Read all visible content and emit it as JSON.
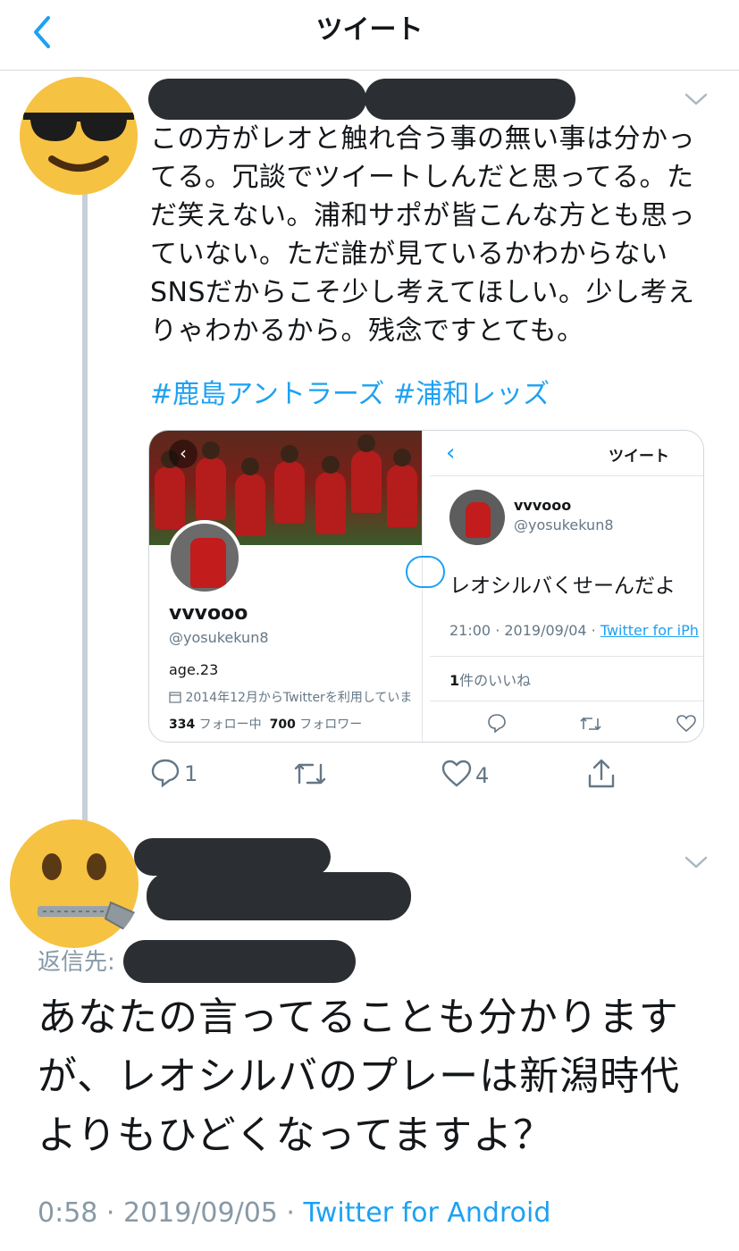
{
  "header": {
    "title": "ツイート"
  },
  "tweet": {
    "text": "この方がレオと触れ合う事の無い事は分かってる。冗談でツイートしんだと思ってる。ただ笑えない。浦和サポが皆こんな方とも思っていない。ただ誰が見ているかわからないSNSだからこそ少し考えてほしい。少し考えりゃわかるから。残念ですとても。",
    "hashtags": [
      "#鹿島アントラーズ",
      "#浦和レッズ"
    ],
    "embedded": {
      "profile": {
        "name": "vvvooo",
        "handle": "@yosukekun8",
        "bio": "age.23",
        "joined": "2014年12月からTwitterを利用していま",
        "following_count": "334",
        "following_label": " フォロー中  ",
        "followers_count": "700",
        "followers_label": " フォロワー"
      },
      "detail": {
        "title": "ツイート",
        "name": "vvvooo",
        "handle": "@yosukekun8",
        "text": "レオシルバくせーんだよ",
        "time": "21:00 · 2019/09/04 · ",
        "source": "Twitter for iPh",
        "likes_count": "1",
        "likes_label": "件のいいね"
      }
    },
    "actions": {
      "reply_count": "1",
      "like_count": "4"
    }
  },
  "reply": {
    "reply_to_label": "返信先:",
    "text": "あなたの言ってることも分かりますが、レオシルバのプレーは新潟時代よりもひどくなってますよ？",
    "time": "0:58 · 2019/09/05 · ",
    "source": "Twitter for Android"
  },
  "colors": {
    "accent": "#1da1f2",
    "muted": "#657786",
    "redaction": "#2b2f33"
  },
  "icons": [
    "back-icon",
    "chevron-down-icon",
    "reply-icon",
    "retweet-icon",
    "like-icon",
    "share-icon",
    "calendar-icon"
  ]
}
